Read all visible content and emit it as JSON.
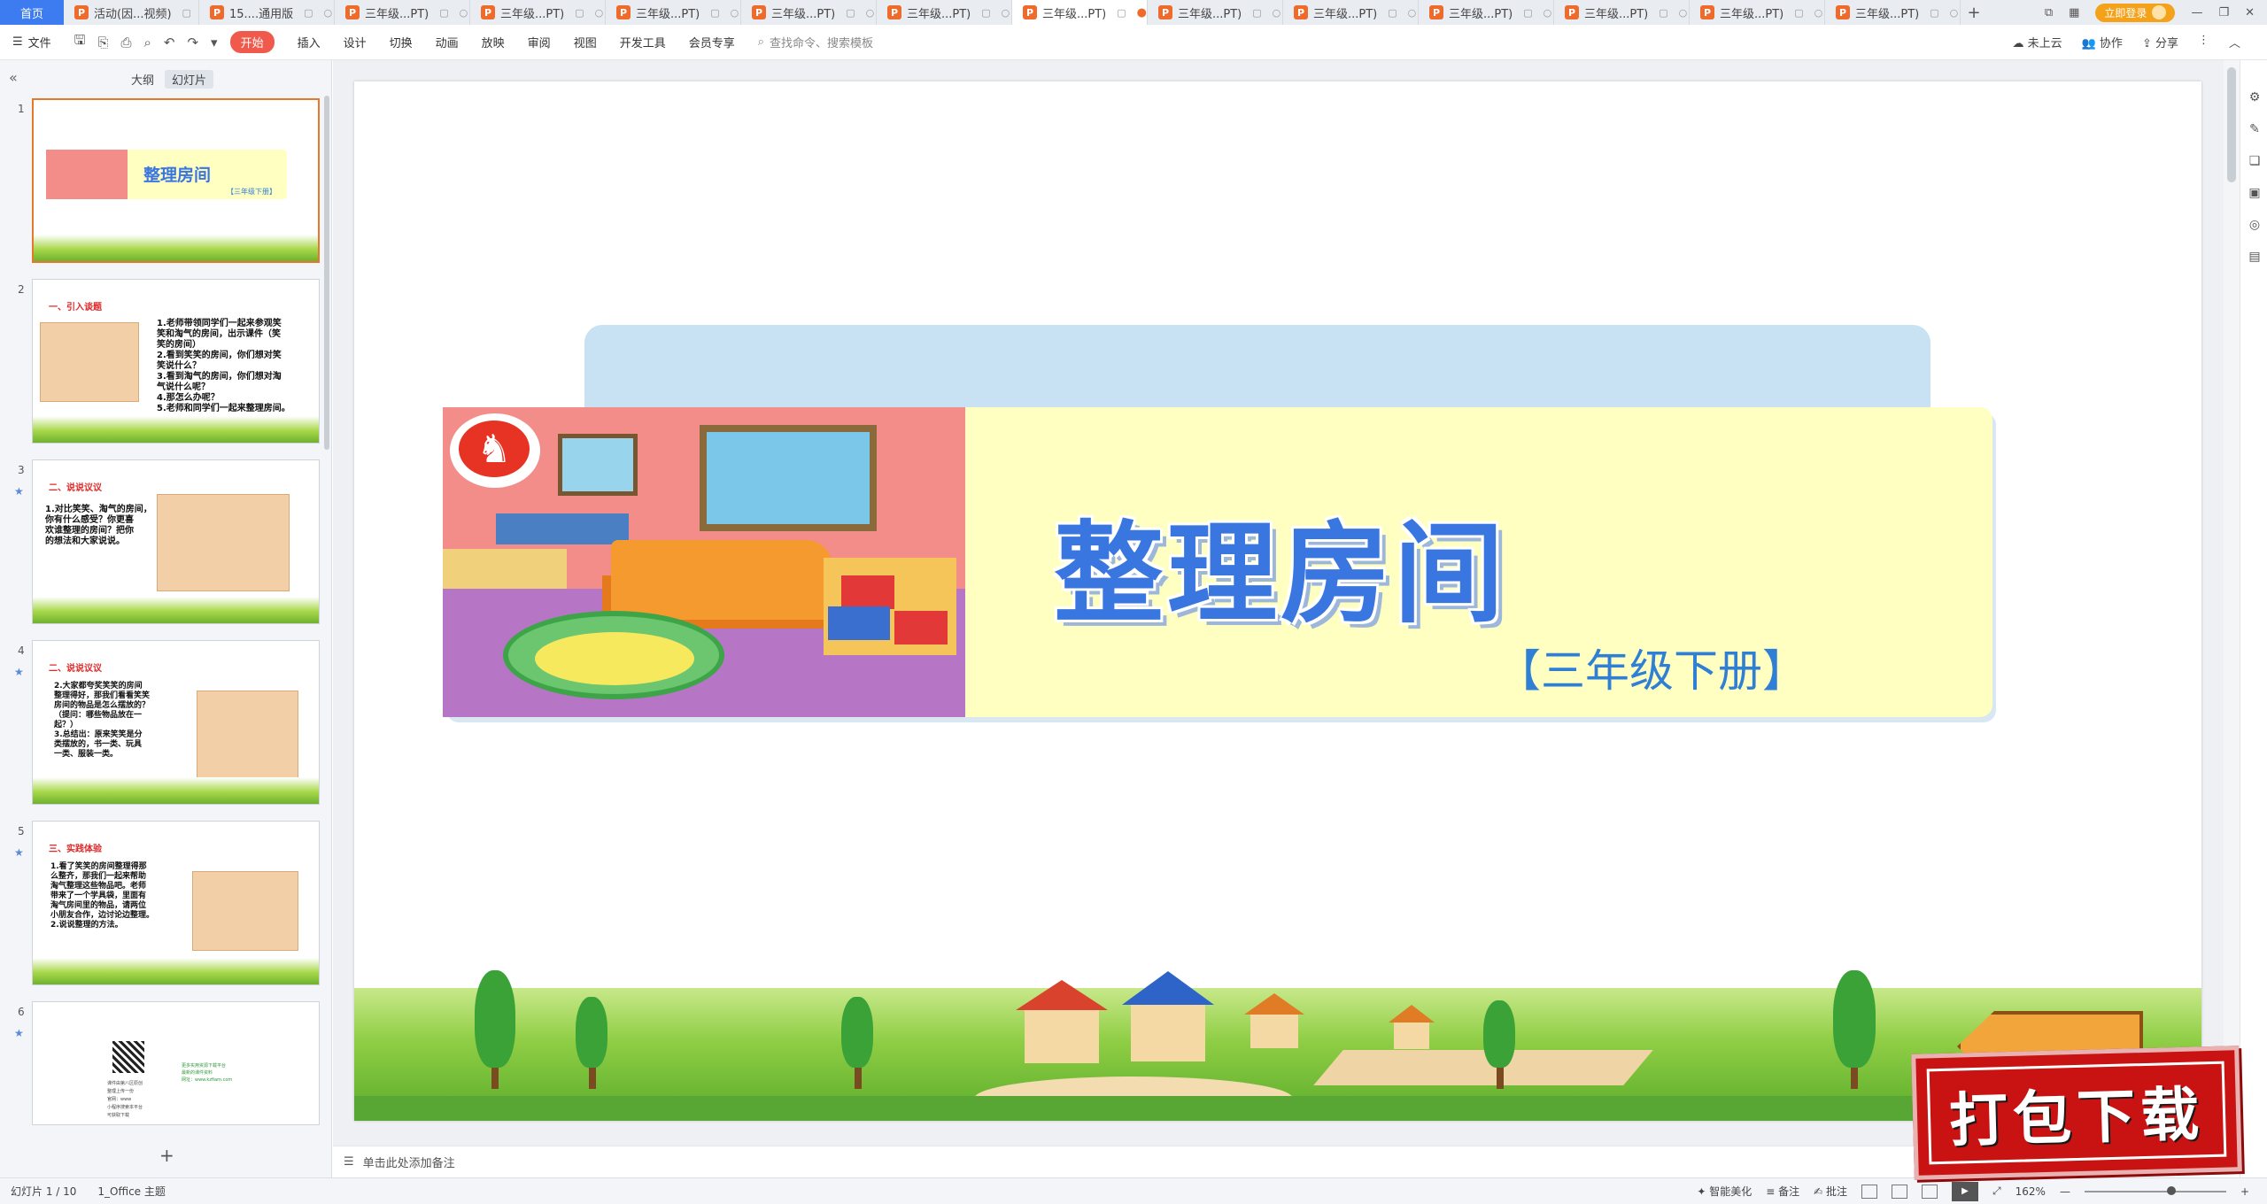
{
  "tabbar": {
    "home": "首页",
    "tabs": [
      {
        "label": "活动(因...视频)",
        "active": false
      },
      {
        "label": "15....通用版",
        "active": false
      },
      {
        "label": "三年级...PT)",
        "active": false
      },
      {
        "label": "三年级...PT)",
        "active": false
      },
      {
        "label": "三年级...PT)",
        "active": false
      },
      {
        "label": "三年级...PT)",
        "active": false
      },
      {
        "label": "三年级...PT)",
        "active": false
      },
      {
        "label": "三年级...PT)",
        "active": true
      },
      {
        "label": "三年级...PT)",
        "active": false
      },
      {
        "label": "三年级...PT)",
        "active": false
      },
      {
        "label": "三年级...PT)",
        "active": false
      },
      {
        "label": "三年级...PT)",
        "active": false
      },
      {
        "label": "三年级...PT)",
        "active": false
      },
      {
        "label": "三年级...PT)",
        "active": false
      }
    ],
    "tab_icon_letter": "P",
    "new_tab": "+",
    "login": "立即登录"
  },
  "menubar": {
    "file": "文件",
    "start": "开始",
    "items": [
      "插入",
      "设计",
      "切换",
      "动画",
      "放映",
      "审阅",
      "视图",
      "开发工具",
      "会员专享"
    ],
    "search_placeholder": "查找命令、搜索模板",
    "right": [
      "未上云",
      "协作",
      "分享"
    ]
  },
  "sidebar": {
    "tabs": [
      "大纲",
      "幻灯片"
    ],
    "active_tab": "幻灯片",
    "slides": [
      {
        "num": "1",
        "title": "整理房间",
        "sub": "【三年级下册】"
      },
      {
        "num": "2",
        "heading": "一、引入谈题",
        "lines": [
          "1.老师带领同学们一起来参观笑",
          "笑和淘气的房间，出示课件（笑",
          "笑的房间）",
          "2.看到笑笑的房间，你们想对笑",
          "笑说什么？",
          "3.看到淘气的房间，你们想对淘",
          "气说什么呢？",
          "4.那怎么办呢？",
          "5.老师和同学们一起来整理房间。"
        ]
      },
      {
        "num": "3",
        "heading": "二、说说议议",
        "lines": [
          "1.对比笑笑、淘气的房间，",
          "你有什么感受？你更喜",
          "欢谁整理的房间？把你",
          "的想法和大家说说。"
        ]
      },
      {
        "num": "4",
        "heading": "二、说说议议",
        "lines": [
          "2.大家都夸奖笑笑的房间",
          "整理得好，那我们看看笑笑",
          "房间的物品是怎么摆放的？",
          "（提问：哪些物品放在一",
          "起？）",
          "3.总结出：原来笑笑是分",
          "类摆放的，书一类、玩具",
          "一类、服装一类。"
        ]
      },
      {
        "num": "5",
        "heading": "三、实践体验",
        "lines": [
          "1.看了笑笑的房间整理得那",
          "么整齐，那我们一起来帮助",
          "淘气整理这些物品吧。老师",
          "带来了一个学具袋，里面有",
          "淘气房间里的物品，请两位",
          "小朋友合作，边讨论边整理。",
          "2.说说整理的方法。"
        ]
      },
      {
        "num": "6",
        "lines": [
          "课件由第八区原创",
          "整理上传一份",
          "官网：www",
          "小程序搜索本平台",
          "可获取下载"
        ],
        "side_lines": [
          "更多实用资源下载平台",
          "最新的课件资料",
          "网址：www.kzfiam.com"
        ]
      }
    ],
    "add": "+"
  },
  "slide": {
    "title": "整理房间",
    "subtitle": "【三年级下册】"
  },
  "notes_placeholder": "单击此处添加备注",
  "statusbar": {
    "slide_info": "幻灯片 1 / 10",
    "theme": "1_Office 主题",
    "right": [
      "智能美化",
      "备注",
      "批注"
    ],
    "zoom": "162%",
    "zoom_fraction": 0.62
  },
  "watermark": "打包下载"
}
